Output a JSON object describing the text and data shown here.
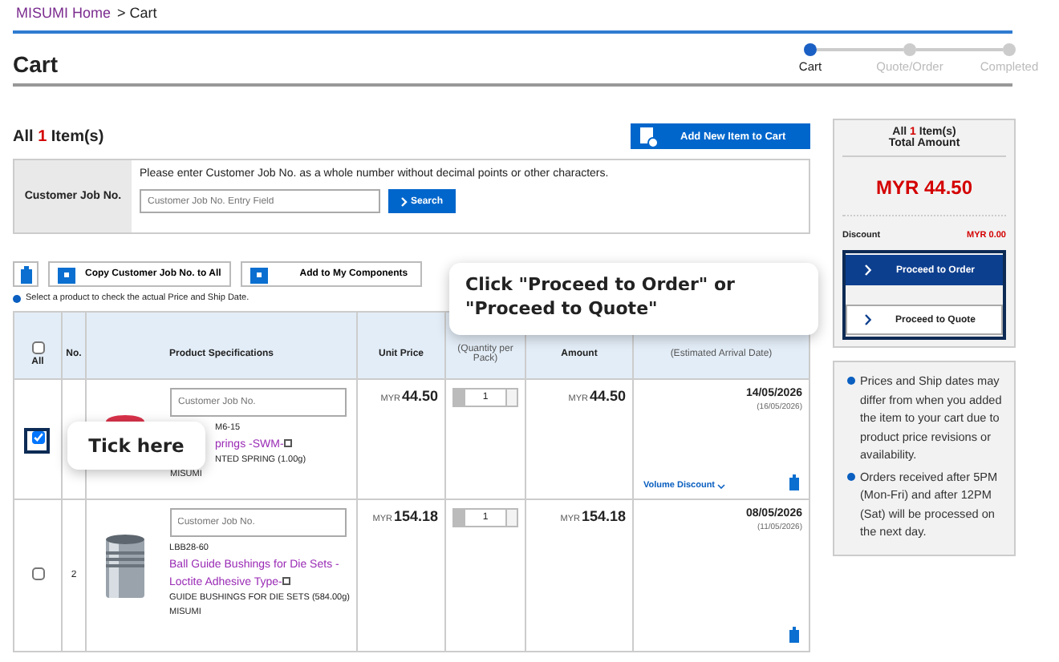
{
  "breadcrumb": {
    "link": "MISUMI Home",
    "current": "> Cart"
  },
  "page_title": "Cart",
  "steps": [
    {
      "label": "Cart",
      "selected": true
    },
    {
      "label": "Quote/Order",
      "selected": false
    },
    {
      "label": "Completed",
      "selected": false
    }
  ],
  "item_count": {
    "prefix": "All",
    "count": "1",
    "suffix": "Item(s)"
  },
  "add_button": "Add New Item to Cart",
  "job_no": {
    "label": "Customer Job No.",
    "instruction": "Please enter Customer Job No. as a whole number without decimal points or other characters.",
    "placeholder": "Customer Job No. Entry Field",
    "search": "Search"
  },
  "toolbar": [
    "Copy Customer Job No. to All",
    "Add to My Components"
  ],
  "note": "Select a product to check the actual Price and Ship Date.",
  "table": {
    "select_all": {
      "label": "All",
      "checked": false
    },
    "columns": [
      "No.",
      "Product Specifications",
      "Unit Price",
      "(Quantity per Pack)",
      "Amount",
      "(Estimated Arrival Date)"
    ],
    "rows": [
      {
        "checked": true,
        "kind": "spring",
        "job_placeholder": "Customer Job No.",
        "part": "M6-15",
        "name": "prings -SWM-",
        "desc": "NTED SPRING (1.00g)",
        "maker": "MISUMI",
        "currency": "MYR",
        "unit_price": "44.50",
        "qty": "1",
        "amount_currency": "MYR",
        "amount": "44.50",
        "ship_date": "14/05/2026",
        "arrival": "(16/05/2026)",
        "volume_discount": "Volume Discount"
      },
      {
        "checked": false,
        "number": "2",
        "kind": "bushing",
        "job_placeholder": "Customer Job No.",
        "part": "LBB28-60",
        "name": "Ball Guide Bushings for Die Sets -Loctite Adhesive Type-",
        "desc": "GUIDE BUSHINGS FOR DIE SETS (584.00g)",
        "maker": "MISUMI",
        "currency": "MYR",
        "unit_price": "154.18",
        "qty": "1",
        "amount_currency": "MYR",
        "amount": "154.18",
        "ship_date": "08/05/2026",
        "arrival": "(11/05/2026)"
      }
    ]
  },
  "summary": {
    "count_prefix": "All",
    "count": "1",
    "count_suffix": "Item(s)",
    "total_label": "Total Amount",
    "total": "MYR 44.50",
    "discount_label": "Discount",
    "discount": "MYR 0.00",
    "buttons": [
      {
        "label": "Proceed to Order",
        "kind": "primary"
      },
      {
        "label": "Proceed to Quote",
        "kind": "secondary"
      }
    ]
  },
  "notices": [
    "Prices and Ship dates may differ from when you added the item to your cart due to product price revisions or availability.",
    "Orders received after 5PM (Mon-Fri) and after 12PM (Sat) will be processed on the next day."
  ],
  "callouts": [
    {
      "kind": "checkbox",
      "text": "Tick here"
    },
    {
      "kind": "proceed",
      "text": "Click \"Proceed to Order\" or \"Proceed to Quote\""
    }
  ]
}
